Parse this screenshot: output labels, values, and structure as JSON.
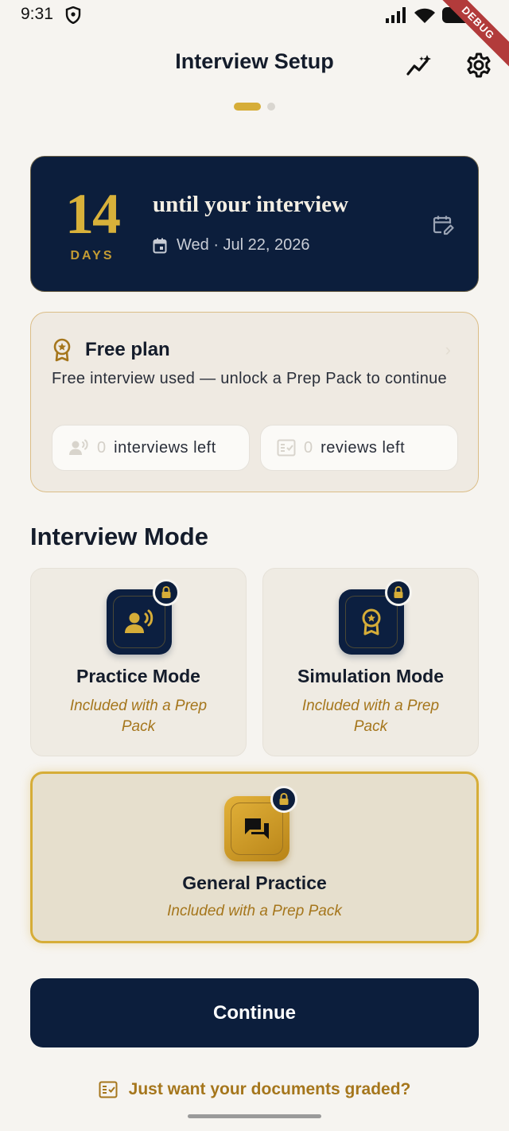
{
  "status_bar": {
    "time": "9:31",
    "debug_label": "DEBUG"
  },
  "header": {
    "title": "Interview Setup",
    "pages": 2,
    "active_page": 1
  },
  "countdown": {
    "number": "14",
    "unit": "DAYS",
    "title": "until your interview",
    "date": "Wed · Jul 22, 2026"
  },
  "plan": {
    "title": "Free plan",
    "description": "Free interview used — unlock a Prep Pack to continue",
    "interviews_count": "0",
    "interviews_label": "interviews left",
    "reviews_count": "0",
    "reviews_label": "reviews left"
  },
  "modes": {
    "section_title": "Interview Mode",
    "practice": {
      "title": "Practice Mode",
      "subtitle": "Included with a Prep Pack"
    },
    "simulation": {
      "title": "Simulation Mode",
      "subtitle": "Included with a Prep Pack"
    },
    "general": {
      "title": "General Practice",
      "subtitle": "Included with a Prep Pack"
    }
  },
  "actions": {
    "continue_label": "Continue",
    "docs_label": "Just want your documents graded?"
  },
  "colors": {
    "navy": "#0c1e3c",
    "gold": "#d6ad38",
    "gold_text": "#a5761c",
    "background": "#f6f4f0"
  }
}
